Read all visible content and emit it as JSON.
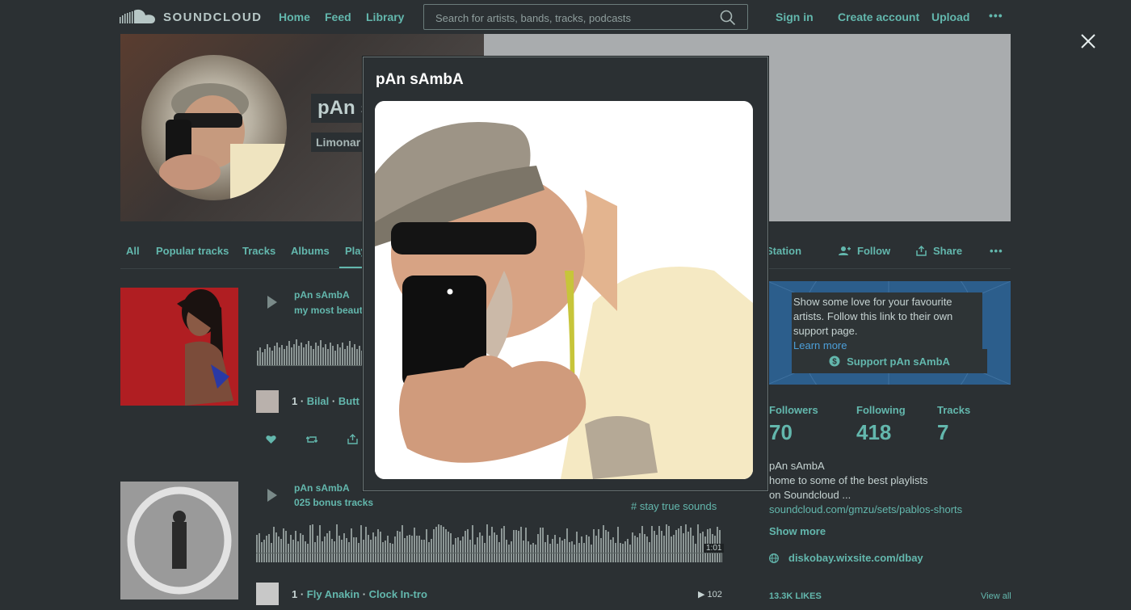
{
  "header": {
    "logo_text": "SOUNDCLOUD",
    "nav": [
      "Home",
      "Feed",
      "Library"
    ],
    "search_placeholder": "Search for artists, bands, tracks, podcasts",
    "sign_in": "Sign in",
    "create_account": "Create account",
    "upload": "Upload",
    "more": "•••"
  },
  "banner": {
    "name": "pΑn sΑmbΑ",
    "subtitle": "Limonar"
  },
  "tabs": [
    "All",
    "Popular tracks",
    "Tracks",
    "Albums",
    "Play"
  ],
  "actions": {
    "station": "Station",
    "follow": "Follow",
    "share": "Share",
    "more": "•••"
  },
  "tracks": [
    {
      "user": "pΑn sΑmbΑ",
      "title": "my most beaut",
      "line_num": "1 ·",
      "line_artist": "Bilal",
      "line_sep": "·",
      "line_track": "Butt"
    },
    {
      "user": "pΑn sΑmbΑ",
      "title": "025 bonus tracks",
      "tag": "# stay true sounds",
      "duration": "1:01",
      "line_num": "1 ·",
      "line_artist": "Fly Anakin",
      "line_sep": "·",
      "line_track": "Clock In-tro",
      "plays": "102"
    }
  ],
  "support": {
    "text": "Show some love for your favourite artists. Follow this link to their own support page.",
    "link": "Learn more",
    "button": "Support pΑn sΑmbΑ"
  },
  "stats": [
    {
      "label": "Followers",
      "value": "70"
    },
    {
      "label": "Following",
      "value": "418"
    },
    {
      "label": "Tracks",
      "value": "7"
    }
  ],
  "bio": {
    "line1": "pΑn sΑmbΑ",
    "line2": "home to some of the best playlists",
    "line3": "on Soundcloud ...",
    "link": "soundcloud.com/gmzu/sets/pablos-shorts"
  },
  "show_more": "Show more",
  "website": "diskobay.wixsite.com/dbay",
  "likes_label": "13.3K LIKES",
  "view_all": "View all",
  "modal": {
    "title": "pΑn sΑmbΑ"
  },
  "colors": {
    "background": "#2b3033",
    "accent": "#63b7ad",
    "support_bg": "#2c5e8c"
  }
}
